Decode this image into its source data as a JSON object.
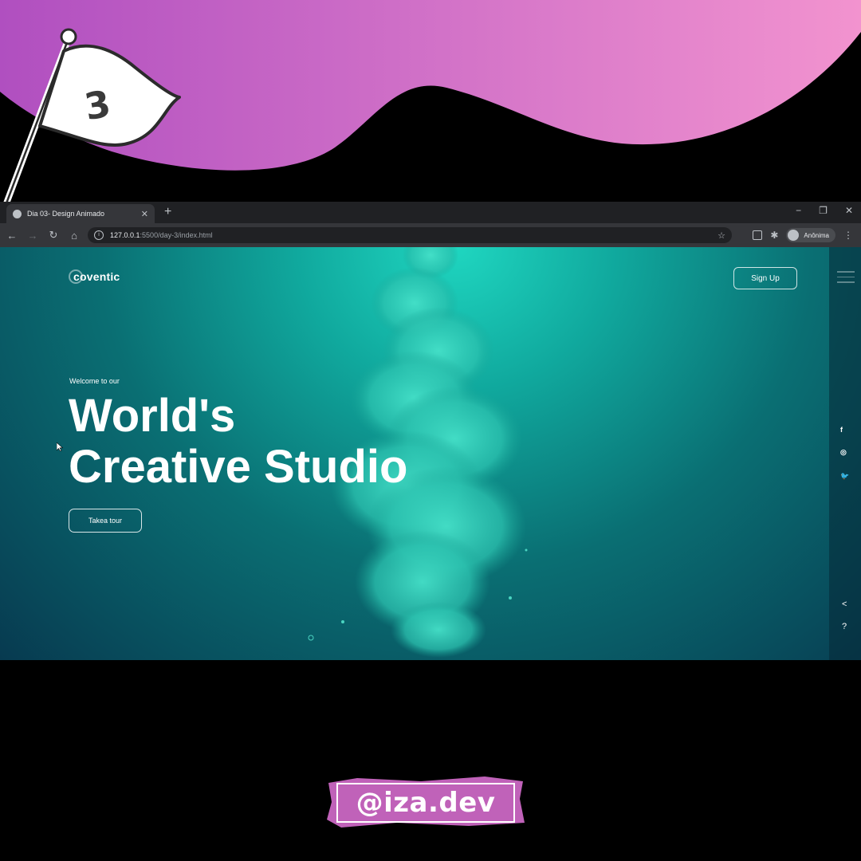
{
  "badge": {
    "step_number": "3"
  },
  "browser": {
    "tab_title": "Dia 03- Design Animado",
    "tab_close": "✕",
    "new_tab": "+",
    "window_controls": [
      "−",
      "❐",
      "✕"
    ],
    "url_host": "127.0.0.1",
    "url_path": ":5500/day-3/index.html",
    "profile_name": "Anônima",
    "icons": [
      "back-icon",
      "forward-icon",
      "reload-icon",
      "home-icon",
      "info-icon",
      "star-icon",
      "extension-icon",
      "puzzle-icon",
      "avatar",
      "menu-icon"
    ]
  },
  "site": {
    "logo": "coventic",
    "signup_label": "Sign Up",
    "welcome": "Welcome to our",
    "headline_line1": "World's",
    "headline_line2": "Creative Studio",
    "tour_label": "Takea tour",
    "social": [
      "f",
      "◎",
      "🐦"
    ],
    "side_arrows": [
      "<",
      "?"
    ]
  },
  "colors": {
    "wave_gradient_start": "#b04fc0",
    "wave_gradient_end": "#f293cf",
    "site_teal": "#10a89d",
    "badge_fill": "#c062b9"
  },
  "handle": "@iza.dev"
}
